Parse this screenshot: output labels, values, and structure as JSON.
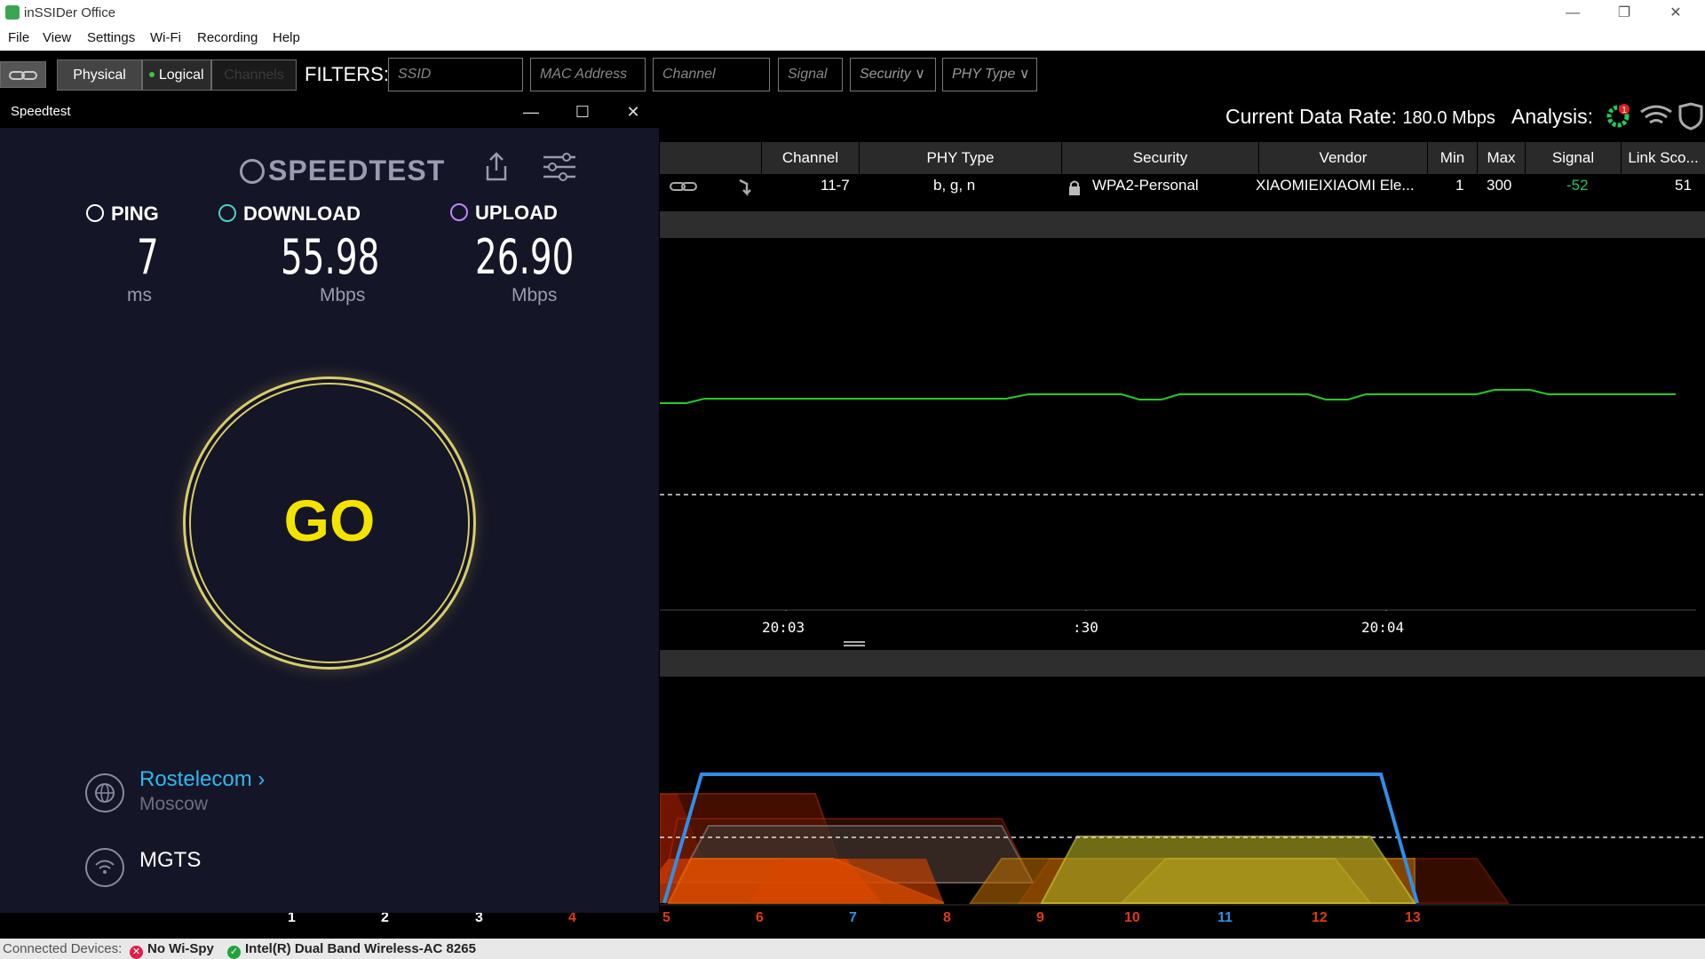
{
  "window": {
    "title": "inSSIDer Office",
    "min": "—",
    "max": "❐",
    "close": "✕"
  },
  "menu": [
    "File",
    "View",
    "Settings",
    "Wi-Fi",
    "Recording",
    "Help"
  ],
  "toolbar": {
    "physical": "Physical",
    "logical": "Logical",
    "channels": "Channels",
    "filters_label": "FILTERS:",
    "ssid": "SSID",
    "mac": "MAC Address",
    "channel": "Channel",
    "signal": "Signal",
    "security": "Security",
    "phy": "PHY Type"
  },
  "speedtest": {
    "title": "Speedtest",
    "logo": "SPEEDTEST",
    "ping_label": "PING",
    "ping_value": "7",
    "ping_unit": "ms",
    "download_label": "DOWNLOAD",
    "download_value": "55.98",
    "download_unit": "Mbps",
    "upload_label": "UPLOAD",
    "upload_value": "26.90",
    "upload_unit": "Mbps",
    "go": "GO",
    "isp": "Rostelecom",
    "isp_location": "Moscow",
    "wifi": "MGTS"
  },
  "right": {
    "current_rate_label": "Current Data Rate:",
    "current_rate_value": "180.0 Mbps",
    "analysis_label": "Analysis:",
    "analysis_badge": "1"
  },
  "table": {
    "headers": [
      "Channel",
      "PHY Type",
      "Security",
      "Vendor",
      "Min",
      "Max",
      "Signal",
      "Link Sco..."
    ],
    "row": {
      "channel": "11-7",
      "phy": "b, g, n",
      "security": "WPA2-Personal",
      "vendor": "XIAOMIEIXIAOMI Ele...",
      "min": "1",
      "max": "300",
      "signal": "-52",
      "link_score": "51"
    }
  },
  "time_axis": [
    "20:03",
    ":30",
    "20:04"
  ],
  "channel_axis": [
    {
      "label": "1",
      "color": "#ffffff"
    },
    {
      "label": "2",
      "color": "#ffffff"
    },
    {
      "label": "3",
      "color": "#ffffff"
    },
    {
      "label": "4",
      "color": "#e03a10"
    },
    {
      "label": "5",
      "color": "#e03a10"
    },
    {
      "label": "6",
      "color": "#e03a10"
    },
    {
      "label": "7",
      "color": "#2f8fe0"
    },
    {
      "label": "8",
      "color": "#e03a10"
    },
    {
      "label": "9",
      "color": "#e03a10"
    },
    {
      "label": "10",
      "color": "#e03a10"
    },
    {
      "label": "11",
      "color": "#2f8fe0"
    },
    {
      "label": "12",
      "color": "#e03a10"
    },
    {
      "label": "13",
      "color": "#e03a10"
    }
  ],
  "status": {
    "label": "Connected Devices:",
    "dev1": "No Wi-Spy",
    "dev2": "Intel(R) Dual Band Wireless-AC 8265"
  }
}
